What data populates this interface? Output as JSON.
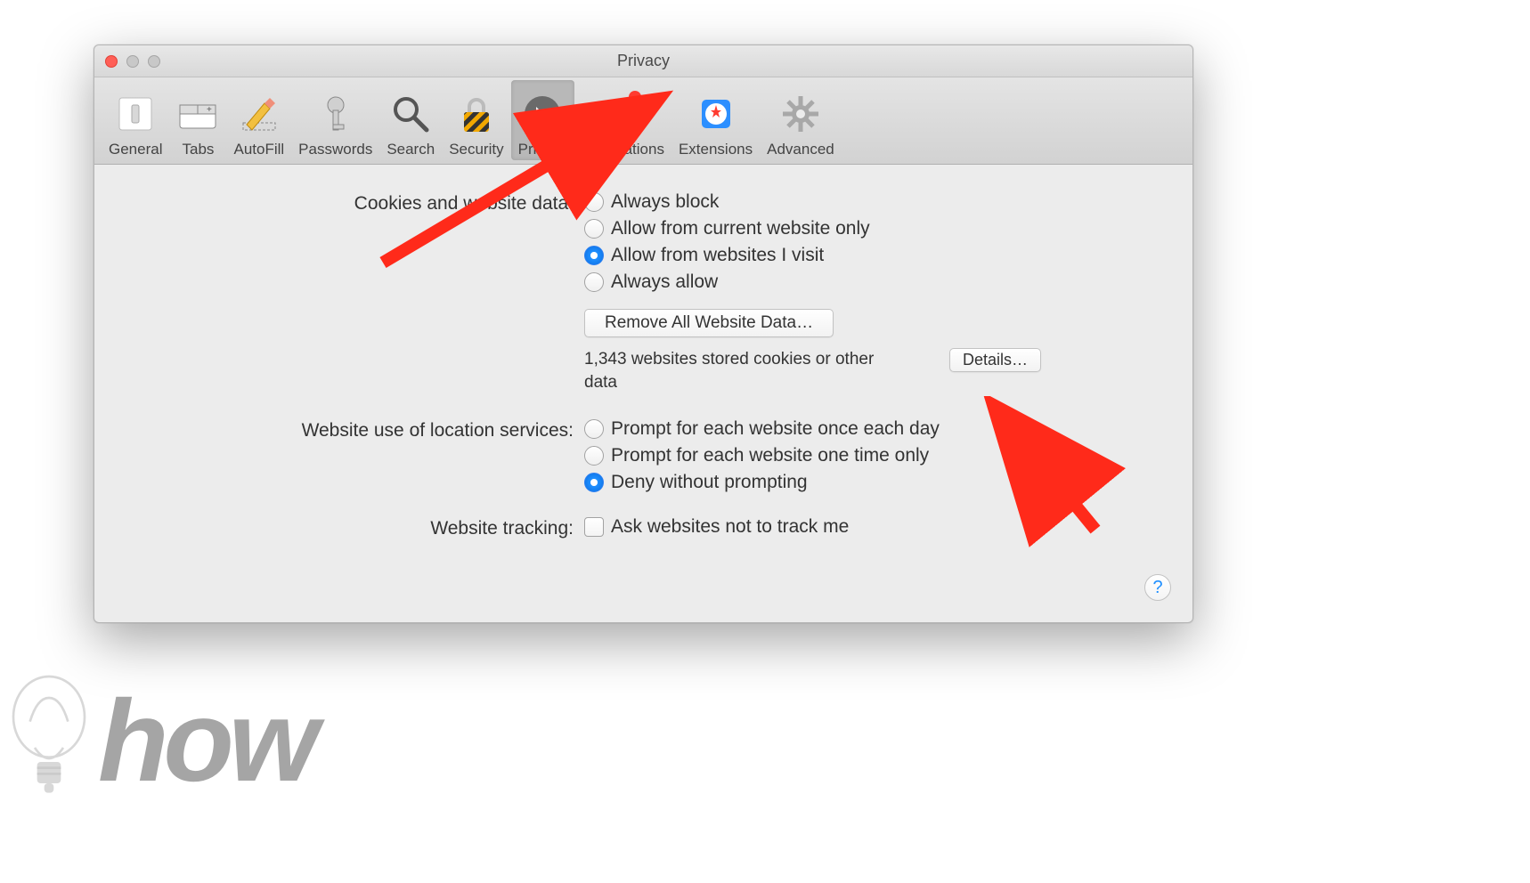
{
  "window": {
    "title": "Privacy"
  },
  "toolbar": {
    "items": [
      {
        "label": "General"
      },
      {
        "label": "Tabs"
      },
      {
        "label": "AutoFill"
      },
      {
        "label": "Passwords"
      },
      {
        "label": "Search"
      },
      {
        "label": "Security"
      },
      {
        "label": "Privacy"
      },
      {
        "label": "Notifications"
      },
      {
        "label": "Extensions"
      },
      {
        "label": "Advanced"
      }
    ]
  },
  "sections": {
    "cookies": {
      "label": "Cookies and website data:",
      "options": [
        "Always block",
        "Allow from current website only",
        "Allow from websites I visit",
        "Always allow"
      ],
      "remove_btn": "Remove All Website Data…",
      "info_text": "1,343 websites stored cookies or other data",
      "details_btn": "Details…"
    },
    "location": {
      "label": "Website use of location services:",
      "options": [
        "Prompt for each website once each day",
        "Prompt for each website one time only",
        "Deny without prompting"
      ]
    },
    "tracking": {
      "label": "Website tracking:",
      "checkbox_label": "Ask websites not to track me"
    }
  },
  "help": "?",
  "watermark_text": "how"
}
